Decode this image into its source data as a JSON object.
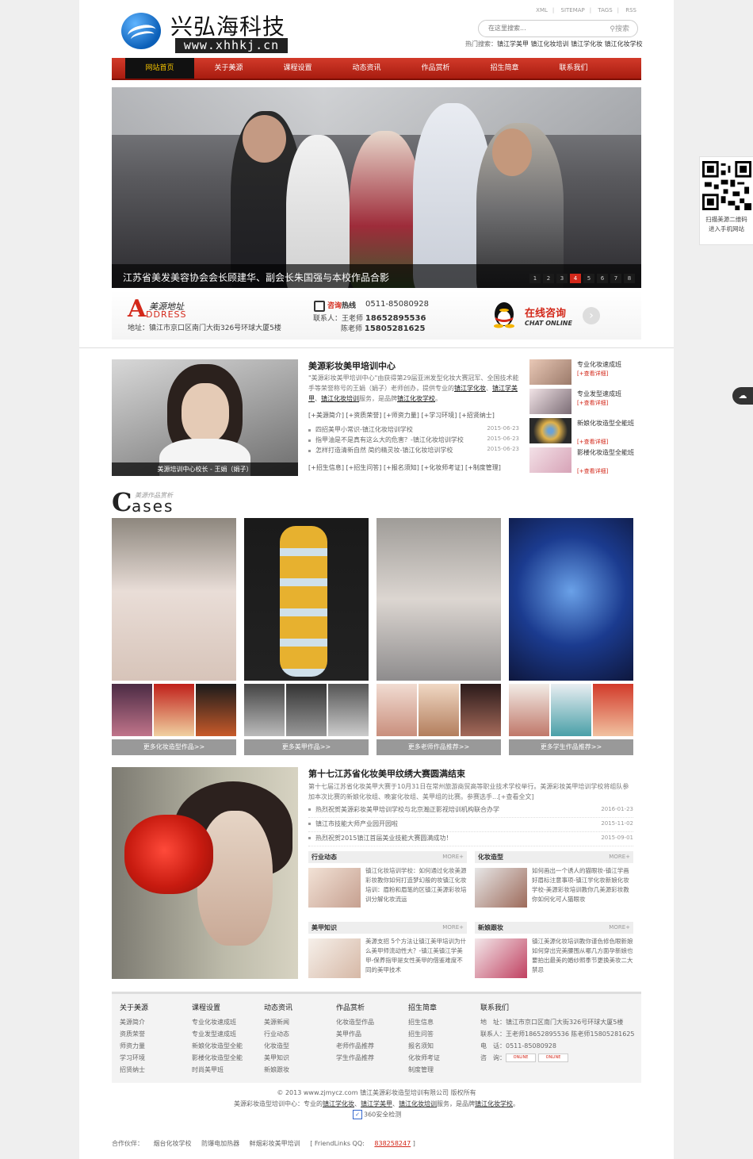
{
  "header": {
    "brand": "兴弘海科技",
    "domain": "www.xhhkj.cn",
    "top_links": [
      "XML",
      "SITEMAP",
      "TAGS",
      "RSS"
    ],
    "search_placeholder": "在这里搜索...",
    "search_button": "搜索",
    "hot_label": "热门搜索：",
    "hot_terms": "镇江学美甲 镇江化妆培训 镇江学化妆 镇江化妆学校"
  },
  "nav": [
    "网站首页",
    "关于美源",
    "课程设置",
    "动态资讯",
    "作品赏析",
    "招生简章",
    "联系我们"
  ],
  "banner": {
    "caption": "江苏省美发美容协会会长顾建华、副会长朱国强与本校作品合影",
    "pages": [
      "1",
      "2",
      "3",
      "4",
      "5",
      "6",
      "7",
      "8"
    ],
    "active_page": 4
  },
  "info": {
    "addr_letter": "A",
    "addr_title": "美源地址",
    "addr_en": "DDRESS",
    "addr_text": "地址：镇江市京口区南门大街326号环球大厦5楼",
    "tel_label_red": "咨询",
    "tel_label_black": "热线",
    "tel_number": "0511-85080928",
    "contact_prefix": "联系人：王老师",
    "contact_phone1": "18652895536",
    "contact_name2": "陈老师",
    "contact_phone2": "15805281625",
    "qq_title": "在线咨询",
    "qq_sub": "CHAT ONLINE"
  },
  "intro": {
    "teacher_caption": "美源培训中心校长 - 王娟（娟子）",
    "title": "美源彩妆美甲培训中心",
    "desc_a": "\"美源彩妆美甲培训中心\"由获得第29届亚洲发型化妆大赛冠军、全国技术能手等荣誉称号的王娟（娟子）老师创办，提供专业的",
    "desc_b1": "镇江学化妆",
    "desc_sep": "、",
    "desc_b2": "镇江学美甲",
    "desc_b3": "镇江化妆培训",
    "desc_c": "服务，是品牌",
    "desc_b4": "镇江化妆学校",
    "desc_end": "。",
    "tags": "[+美源简介]  [+资质荣誉]  [+师资力量]  [+学习环境]  [+招贤纳士]",
    "news": [
      {
        "title": "四招美甲小常识-镇江化妆培训学校",
        "date": "2015-06-23"
      },
      {
        "title": "指甲油是不是真有这么大的危害？-镇江化妆培训学校",
        "date": "2015-06-23"
      },
      {
        "title": "怎样打造清新自然 简约精灵妆-镇江化妆培训学校",
        "date": "2015-06-23"
      }
    ],
    "tags2": "[+招生信息]  [+招生问答]  [+报名须知]  [+化妆师考证]  [+制度管理]",
    "side": [
      {
        "title": "专业化妆速成班",
        "more": "[+查看详细]"
      },
      {
        "title": "专业发型速成班",
        "more": "[+查看详细]"
      },
      {
        "title": "新娘化妆造型全能班",
        "more": "[+查看详细]"
      },
      {
        "title": "影楼化妆造型全能班",
        "more": "[+查看详细]"
      }
    ]
  },
  "cases": {
    "C": "C",
    "rest": "ases",
    "cn": "美源作品赏析",
    "more": [
      "更多化妆造型作品>>",
      "更多美甲作品>>",
      "更多老师作品推荐>>",
      "更多学生作品推荐>>"
    ]
  },
  "news": {
    "title": "第十七江苏省化妆美甲纹绣大赛圆满结束",
    "desc": "第十七届江苏省化妆美甲大赛于10月31日在常州旅游商贸高等职业技术学校举行。美源彩妆美甲培训学校将组队参加本次比赛的新娘化妆组、晚宴化妆组、美甲组的比赛。参赛选手...[+查看全文]",
    "list": [
      {
        "title": "热烈祝贺美源彩妆美甲培训学校与北京瀚正影视培训机构联合办学",
        "date": "2016-01-23"
      },
      {
        "title": "镇江市技能大师产业园开园啦",
        "date": "2015-11-02"
      },
      {
        "title": "热烈祝贺2015镇江首届美业技能大赛圆满成功！",
        "date": "2015-09-01"
      }
    ],
    "boxes": [
      {
        "title": "行业动态",
        "more": "MORE+",
        "text": "镇江化妆培训学校：如何通过化妆美源彩妆教你如何打造梦幻般的妆镇江化妆培训：眉粉和眉笔的区镇江美源彩妆培训分解化妆流运"
      },
      {
        "title": "化妆造型",
        "more": "MORE+",
        "text": "如何画出一个诱人的猫眼妆-镇江学画好眉标注意事项-镇江学化妆新娘化妆学校-美源彩妆培训教你几美源彩妆教你如何化可人猫眼妆"
      },
      {
        "title": "美甲知识",
        "more": "MORE+",
        "text": "美源支招 5个方法让镇江美甲培训为什么美甲师流动性大？-镇江美镇江学美甲-保养指甲是女性美甲的借鉴难度不同的美甲技术"
      },
      {
        "title": "新娘跟妆",
        "more": "MORE+",
        "text": "镇江美源化妆培训教你谨色修色眼新娘如何穿出完美腰围从哪几方面孕新娘也要拍出最美的婚纱照季节更换美妆二大禁忌"
      }
    ]
  },
  "footer": {
    "cols": [
      {
        "head": "关于美源",
        "items": [
          "美源简介",
          "资质荣誉",
          "师资力量",
          "学习环境",
          "招贤纳士"
        ]
      },
      {
        "head": "课程设置",
        "items": [
          "专业化妆速成班",
          "专业发型速成班",
          "新娘化妆造型全能",
          "影楼化妆造型全能",
          "时尚美甲班"
        ]
      },
      {
        "head": "动态资讯",
        "items": [
          "美源新闻",
          "行业动态",
          "化妆造型",
          "美甲知识",
          "新娘跟妆"
        ]
      },
      {
        "head": "作品赏析",
        "items": [
          "化妆造型作品",
          "美甲作品",
          "老师作品推荐",
          "学生作品推荐"
        ]
      },
      {
        "head": "招生简章",
        "items": [
          "招生信息",
          "招生问答",
          "报名须知",
          "化妆师考证",
          "制度管理"
        ]
      }
    ],
    "contact_head": "联系我们",
    "contact_addr": "地　址：镇江市京口区南门大街326号环球大厦5楼",
    "contact_person": "联系人：王老师18652895536 陈老师15805281625",
    "contact_tel": "电　话：0511-85080928",
    "contact_qq": "咨　询：",
    "online": "ONLINE",
    "copyright": "© 2013 www.zjmycz.com 镇江美源彩妆造型培训有限公司 版权所有",
    "line2_a": "美源彩妆造型培训中心：专业的",
    "line2_b1": "镇江学化妆",
    "line2_b2": "镇江学美甲",
    "line2_b3": "镇江化妆培训",
    "line2_c": "服务，是品牌",
    "line2_b4": "镇江化妆学校",
    "line2_end": "。",
    "safe": "360安全检测",
    "partners_label": "合作伙伴：",
    "partners": [
      "烟台化妆学校",
      "防爆电加热器",
      "鲜烟彩妆美甲培训"
    ],
    "friendlinks_pre": "[ FriendLinks QQ: ",
    "friendlinks_qq": "838258247",
    "friendlinks_post": " ]"
  },
  "side_qr": {
    "line1": "扫描美源二维码",
    "line2": "进入手机网站"
  },
  "colors": {
    "accent": "#d3281a",
    "nav_active_text": "#f5c400"
  }
}
